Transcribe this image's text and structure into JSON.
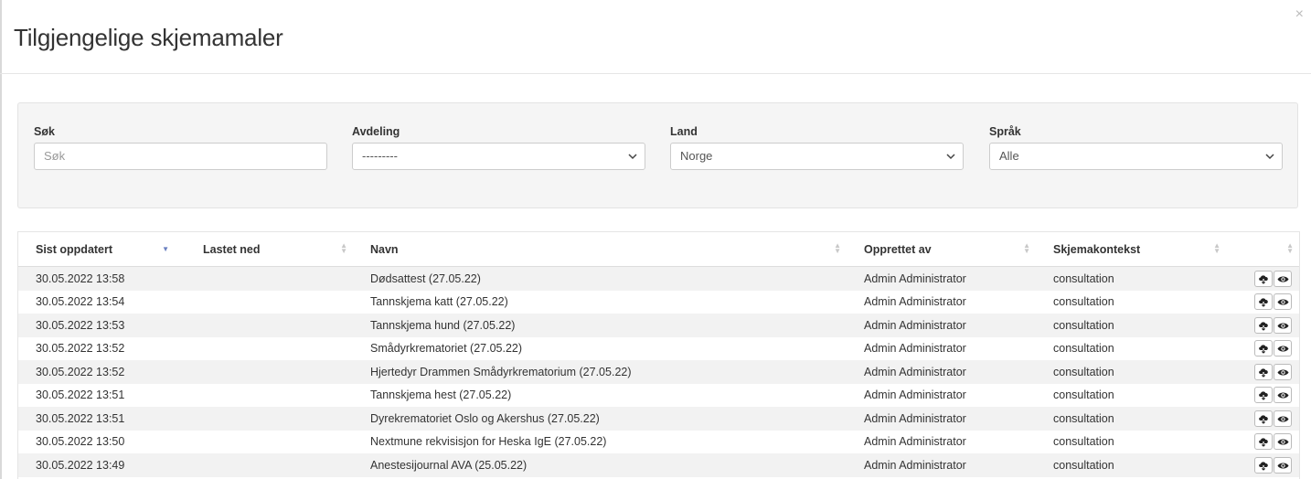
{
  "modal": {
    "title": "Tilgjengelige skjemamaler",
    "close_label": "×"
  },
  "filters": {
    "search": {
      "label": "Søk",
      "placeholder": "Søk"
    },
    "department": {
      "label": "Avdeling",
      "value": "---------"
    },
    "country": {
      "label": "Land",
      "value": "Norge"
    },
    "language": {
      "label": "Språk",
      "value": "Alle"
    }
  },
  "table": {
    "columns": [
      "Sist oppdatert",
      "Lastet ned",
      "Navn",
      "Opprettet av",
      "Skjemakontekst",
      ""
    ],
    "sorted_column": "Sist oppdatert",
    "sort_direction": "desc",
    "rows": [
      {
        "updated": "30.05.2022 13:58",
        "downloaded": "",
        "name": "Dødsattest (27.05.22)",
        "created_by": "Admin Administrator",
        "context": "consultation"
      },
      {
        "updated": "30.05.2022 13:54",
        "downloaded": "",
        "name": "Tannskjema katt (27.05.22)",
        "created_by": "Admin Administrator",
        "context": "consultation"
      },
      {
        "updated": "30.05.2022 13:53",
        "downloaded": "",
        "name": "Tannskjema hund (27.05.22)",
        "created_by": "Admin Administrator",
        "context": "consultation"
      },
      {
        "updated": "30.05.2022 13:52",
        "downloaded": "",
        "name": "Smådyrkrematoriet (27.05.22)",
        "created_by": "Admin Administrator",
        "context": "consultation"
      },
      {
        "updated": "30.05.2022 13:52",
        "downloaded": "",
        "name": "Hjertedyr Drammen Smådyrkrematorium (27.05.22)",
        "created_by": "Admin Administrator",
        "context": "consultation"
      },
      {
        "updated": "30.05.2022 13:51",
        "downloaded": "",
        "name": "Tannskjema hest (27.05.22)",
        "created_by": "Admin Administrator",
        "context": "consultation"
      },
      {
        "updated": "30.05.2022 13:51",
        "downloaded": "",
        "name": "Dyrekrematoriet Oslo og Akershus (27.05.22)",
        "created_by": "Admin Administrator",
        "context": "consultation"
      },
      {
        "updated": "30.05.2022 13:50",
        "downloaded": "",
        "name": "Nextmune rekvisisjon for Heska IgE (27.05.22)",
        "created_by": "Admin Administrator",
        "context": "consultation"
      },
      {
        "updated": "30.05.2022 13:49",
        "downloaded": "",
        "name": "Anestesijournal AVA (25.05.22)",
        "created_by": "Admin Administrator",
        "context": "consultation"
      }
    ],
    "row_actions": [
      "cloud-download-icon",
      "eye-icon"
    ]
  },
  "colors": {
    "sort_active": "#6a7fc0",
    "panel_bg": "#f5f5f5",
    "row_stripe": "#f2f2f2"
  }
}
